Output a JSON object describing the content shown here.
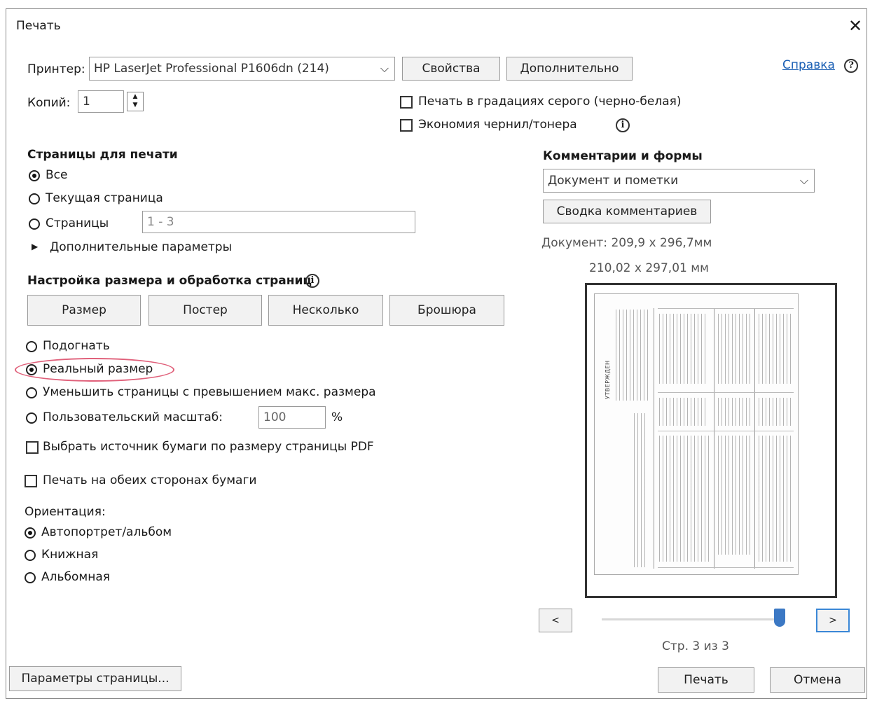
{
  "window": {
    "title": "Печать",
    "close": "✕"
  },
  "printer": {
    "label": "Принтер:",
    "selected": "HP LaserJet Professional P1606dn (214)",
    "properties_btn": "Свойства",
    "advanced_btn": "Дополнительно",
    "help_link": "Справка"
  },
  "copies": {
    "label": "Копий:",
    "value": "1"
  },
  "options": {
    "grayscale": "Печать в градациях серого (черно-белая)",
    "save_ink": "Экономия чернил/тонера"
  },
  "pages": {
    "heading": "Страницы для печати",
    "all": "Все",
    "current": "Текущая страница",
    "range_label": "Страницы",
    "range_value": "1 - 3",
    "more": "Дополнительные параметры",
    "selected": "all"
  },
  "sizing": {
    "heading": "Настройка размера и обработка страниц",
    "tabs": [
      "Размер",
      "Постер",
      "Несколько",
      "Брошюра"
    ],
    "fit": "Подогнать",
    "actual": "Реальный размер",
    "shrink": "Уменьшить страницы с превышением макс. размера",
    "custom": "Пользовательский масштаб:",
    "custom_value": "100",
    "percent": "%",
    "selected": "actual",
    "paper_source": "Выбрать источник бумаги по размеру страницы PDF",
    "duplex": "Печать на обеих сторонах бумаги"
  },
  "orientation": {
    "heading": "Ориентация:",
    "auto": "Автопортрет/альбом",
    "portrait": "Книжная",
    "landscape": "Альбомная",
    "selected": "auto"
  },
  "comments": {
    "heading": "Комментарии и формы",
    "selected": "Документ и пометки",
    "summary_btn": "Сводка комментариев",
    "doc_size": "Документ: 209,9 x 296,7мм",
    "paper_size": "210,02 x 297,01 мм"
  },
  "preview": {
    "prev": "<",
    "next": ">",
    "page_status": "Стр. 3 из 3",
    "current_page": 3,
    "total_pages": 3,
    "slider_fraction": 1.0
  },
  "footer": {
    "page_setup": "Параметры страницы...",
    "print": "Печать",
    "cancel": "Отмена"
  },
  "colors": {
    "help_link": "#1a5fb4",
    "highlight_ring": "#e0607a",
    "slider_thumb": "#3b78c4",
    "focus": "#3a87d6"
  }
}
